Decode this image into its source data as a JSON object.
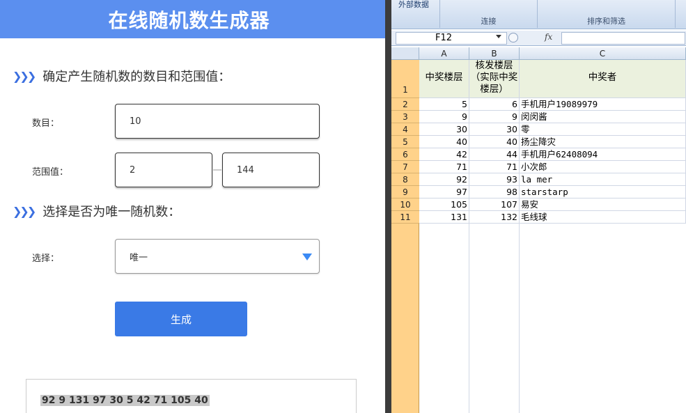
{
  "web": {
    "title": "在线随机数生成器",
    "section1": "确定产生随机数的数目和范围值：",
    "count_label": "数目：",
    "count_value": "10",
    "range_label": "范围值：",
    "range_min": "2",
    "range_max": "144",
    "section2": "选择是否为唯一随机数：",
    "choice_label": "选择：",
    "choice_value": "唯一",
    "generate_label": "生成",
    "result": "92 9 131 97 30 5 42 71 105 40",
    "chev": "❯❯❯"
  },
  "excel": {
    "ribbon": {
      "external_data": "外部数据",
      "group_connection": "连接",
      "group_sort_filter": "排序和筛选"
    },
    "name_box": "F12",
    "fx": "fx",
    "columns": [
      "A",
      "B",
      "C"
    ],
    "header_row": {
      "row": "1",
      "a": "中奖楼层",
      "b": "核发楼层（实际中奖楼层）",
      "c": "中奖者"
    },
    "rows": [
      {
        "row": "2",
        "a": "5",
        "b": "6",
        "c": "手机用户19089979"
      },
      {
        "row": "3",
        "a": "9",
        "b": "9",
        "c": "闵闵酱"
      },
      {
        "row": "4",
        "a": "30",
        "b": "30",
        "c": "零"
      },
      {
        "row": "5",
        "a": "40",
        "b": "40",
        "c": "扬尘降灾"
      },
      {
        "row": "6",
        "a": "42",
        "b": "44",
        "c": "手机用户62408094"
      },
      {
        "row": "7",
        "a": "71",
        "b": "71",
        "c": "小次郎"
      },
      {
        "row": "8",
        "a": "92",
        "b": "93",
        "c": "la mer"
      },
      {
        "row": "9",
        "a": "97",
        "b": "98",
        "c": "starstarp"
      },
      {
        "row": "10",
        "a": "105",
        "b": "107",
        "c": "易安"
      },
      {
        "row": "11",
        "a": "131",
        "b": "132",
        "c": "毛线球"
      }
    ]
  }
}
